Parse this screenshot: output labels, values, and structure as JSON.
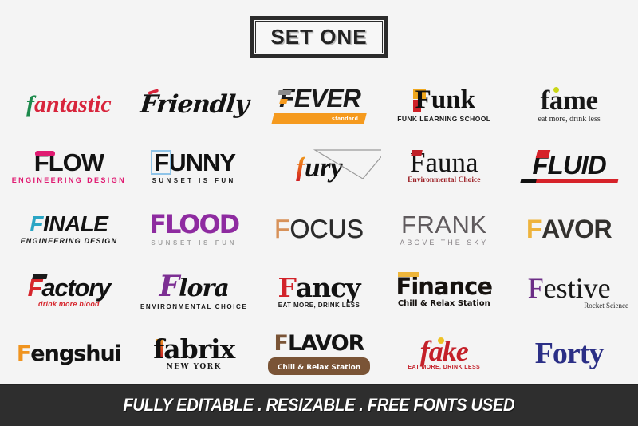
{
  "header": {
    "badge_label": "SET ONE"
  },
  "footer": {
    "text": "FULLY EDITABLE . RESIZABLE . FREE FONTS USED",
    "background_color": "#2e2e2e",
    "text_color": "#ffffff"
  },
  "page": {
    "background_color": "#f4f4f4"
  },
  "logos": [
    {
      "id": "fantastic",
      "name": "fantastic",
      "name_parts": {
        "accent": "f",
        "rest": "antastic"
      },
      "subtitle": "",
      "colors": {
        "primary": "#d8253c",
        "accent": "#1d8a4c"
      },
      "style": "italic-serif-script"
    },
    {
      "id": "friendly",
      "name": "Friendly",
      "subtitle": "",
      "colors": {
        "primary": "#141414",
        "accent": "#d8253c"
      },
      "style": "brush-script"
    },
    {
      "id": "fever",
      "name": "FEVER",
      "subtitle": "standard",
      "colors": {
        "primary": "#1b1b1b",
        "accent": "#f59a1e",
        "secondary": "#8b8b8b"
      },
      "style": "italic-bold-sans"
    },
    {
      "id": "funk",
      "name": "Funk",
      "name_parts": {
        "accent": "F",
        "rest": "unk"
      },
      "subtitle": "FUNK LEARNING SCHOOL",
      "colors": {
        "primary": "#111111",
        "accent": "#f0a81e",
        "secondary": "#cf2027"
      },
      "style": "bold-serif"
    },
    {
      "id": "fame",
      "name": "fame",
      "subtitle": "eat more, drink less",
      "colors": {
        "primary": "#171717",
        "accent": "#c9d617"
      },
      "style": "bold-serif"
    },
    {
      "id": "flow",
      "name": "FLOW",
      "subtitle": "ENGINEERING DESIGN",
      "colors": {
        "primary": "#131313",
        "accent": "#e01b72"
      },
      "style": "bold-sans"
    },
    {
      "id": "funny",
      "name": "FUNNY",
      "name_parts": {
        "accent": "F",
        "rest": "UNNY"
      },
      "subtitle": "SUNSET IS FUN",
      "colors": {
        "primary": "#111111",
        "accent": "#8fc4e8"
      },
      "style": "bold-sans"
    },
    {
      "id": "fury",
      "name": "fury",
      "name_parts": {
        "accent": "f",
        "rest": "ury"
      },
      "subtitle": "",
      "colors": {
        "primary": "#111111",
        "accent": "#e8611a"
      },
      "style": "italic-serif"
    },
    {
      "id": "fauna",
      "name": "Fauna",
      "subtitle": "Environmental Choice",
      "colors": {
        "primary": "#141414",
        "accent": "#c02028"
      },
      "style": "serif"
    },
    {
      "id": "fluid",
      "name": "FLUID",
      "subtitle": "",
      "colors": {
        "primary": "#121212",
        "accent": "#d62229"
      },
      "style": "italic-bold-sans"
    },
    {
      "id": "finale",
      "name": "FINALE",
      "name_parts": {
        "accent": "F",
        "rest": "INALE"
      },
      "subtitle": "ENGINEERING DESIGN",
      "colors": {
        "primary": "#141414",
        "accent": "#2aa5c4"
      },
      "style": "italic-bold-sans"
    },
    {
      "id": "flood",
      "name": "FLOOD",
      "subtitle": "SUNSET IS FUN",
      "colors": {
        "primary": "#8e2ba0",
        "accent": "#a3a3a3"
      },
      "style": "bold-rounded-sans"
    },
    {
      "id": "focus",
      "name": "FOCUS",
      "name_parts": {
        "accent": "F",
        "rest": "OCUS"
      },
      "subtitle": "",
      "colors": {
        "primary": "#2a2a2a",
        "accent": "#d79159"
      },
      "style": "thin-sans"
    },
    {
      "id": "frank",
      "name": "FRANK",
      "subtitle": "ABOVE THE SKY",
      "colors": {
        "primary": "#5f5a5d",
        "accent": "#8a8589"
      },
      "style": "thin-sans"
    },
    {
      "id": "favor",
      "name": "FAVOR",
      "name_parts": {
        "accent": "F",
        "rest": "AVOR"
      },
      "subtitle": "",
      "colors": {
        "primary": "#33312e",
        "accent": "#eeb33c"
      },
      "style": "bold-sans"
    },
    {
      "id": "factory",
      "name": "Factory",
      "name_parts": {
        "accent": "F",
        "rest": "actory"
      },
      "subtitle": "drink more blood",
      "colors": {
        "primary": "#111111",
        "accent": "#d6252c"
      },
      "style": "italic-bold-sans"
    },
    {
      "id": "flora",
      "name": "Flora",
      "name_parts": {
        "accent": "F",
        "rest": "lora"
      },
      "subtitle": "ENVIRONMENTAL CHOICE",
      "colors": {
        "primary": "#121212",
        "accent": "#7c2f93"
      },
      "style": "script"
    },
    {
      "id": "fancy",
      "name": "Fancy",
      "name_parts": {
        "accent": "F",
        "rest": "ancy"
      },
      "subtitle": "EAT MORE, DRINK LESS",
      "colors": {
        "primary": "#131313",
        "accent": "#d2232a"
      },
      "style": "bold-slab-serif"
    },
    {
      "id": "finance",
      "name": "Finance",
      "subtitle": "Chill & Relax Station",
      "colors": {
        "primary": "#16120f",
        "accent": "#edb53a"
      },
      "style": "bold-sans"
    },
    {
      "id": "festive",
      "name": "Festive",
      "name_parts": {
        "accent": "F",
        "rest": "estive"
      },
      "subtitle": "Rocket Science",
      "colors": {
        "primary": "#181818",
        "accent": "#6b2d86"
      },
      "style": "serif"
    },
    {
      "id": "fengshui",
      "name": "Fengshui",
      "name_parts": {
        "accent": "F",
        "rest": "engshui"
      },
      "subtitle": "",
      "colors": {
        "primary": "#121212",
        "accent": "#f0941f"
      },
      "style": "bold-rounded-sans"
    },
    {
      "id": "fabrix",
      "name": "fabrix",
      "subtitle": "NEW YORK",
      "colors": {
        "primary": "#111111",
        "accent": "#e0551f"
      },
      "style": "bold-serif"
    },
    {
      "id": "flavor",
      "name": "FLAVOR",
      "name_parts": {
        "accent": "F",
        "rest": "LAVOR"
      },
      "subtitle": "Chill & Relax Station",
      "colors": {
        "primary": "#141414",
        "accent": "#7a5436"
      },
      "style": "bold-rounded-sans"
    },
    {
      "id": "fake",
      "name": "fake",
      "subtitle": "EAT MORE, DRINK LESS",
      "colors": {
        "primary": "#c42029",
        "accent": "#eec225"
      },
      "style": "italic-serif"
    },
    {
      "id": "forty",
      "name": "Forty",
      "subtitle": "",
      "colors": {
        "primary": "#2b2f86"
      },
      "style": "bold-serif"
    }
  ]
}
